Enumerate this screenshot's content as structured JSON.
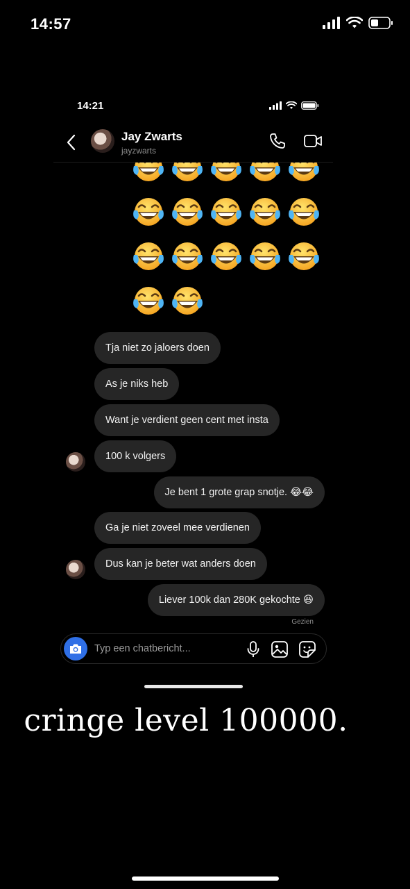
{
  "outer_status": {
    "time": "14:57"
  },
  "inner_status": {
    "time": "14:21"
  },
  "chat": {
    "contact_name": "Jay Zwarts",
    "contact_handle": "jayzwarts",
    "emoji_rows": [
      5,
      5,
      5,
      2
    ],
    "emoji_icon": "face-with-tears-of-joy",
    "messages": [
      {
        "dir": "in",
        "text": "Tja niet zo jaloers doen"
      },
      {
        "dir": "in",
        "text": "As je niks heb"
      },
      {
        "dir": "in",
        "text": "Want je verdient geen cent met insta"
      },
      {
        "dir": "in",
        "text": "100 k volgers"
      },
      {
        "dir": "out",
        "text": "Je bent 1 grote grap snotje. 😂😂"
      },
      {
        "dir": "in",
        "text": "Ga je niet zoveel mee verdienen"
      },
      {
        "dir": "in",
        "text": "Dus kan je beter wat anders doen"
      },
      {
        "dir": "out",
        "text": "Liever 100k dan 280K gekochte 😆"
      }
    ],
    "seen_label": "Gezien"
  },
  "composer": {
    "placeholder": "Typ een chatbericht..."
  },
  "caption": "cringe level 100000.",
  "colors": {
    "bubble": "#262626",
    "camera": "#2f6fe6",
    "background": "#000000"
  }
}
